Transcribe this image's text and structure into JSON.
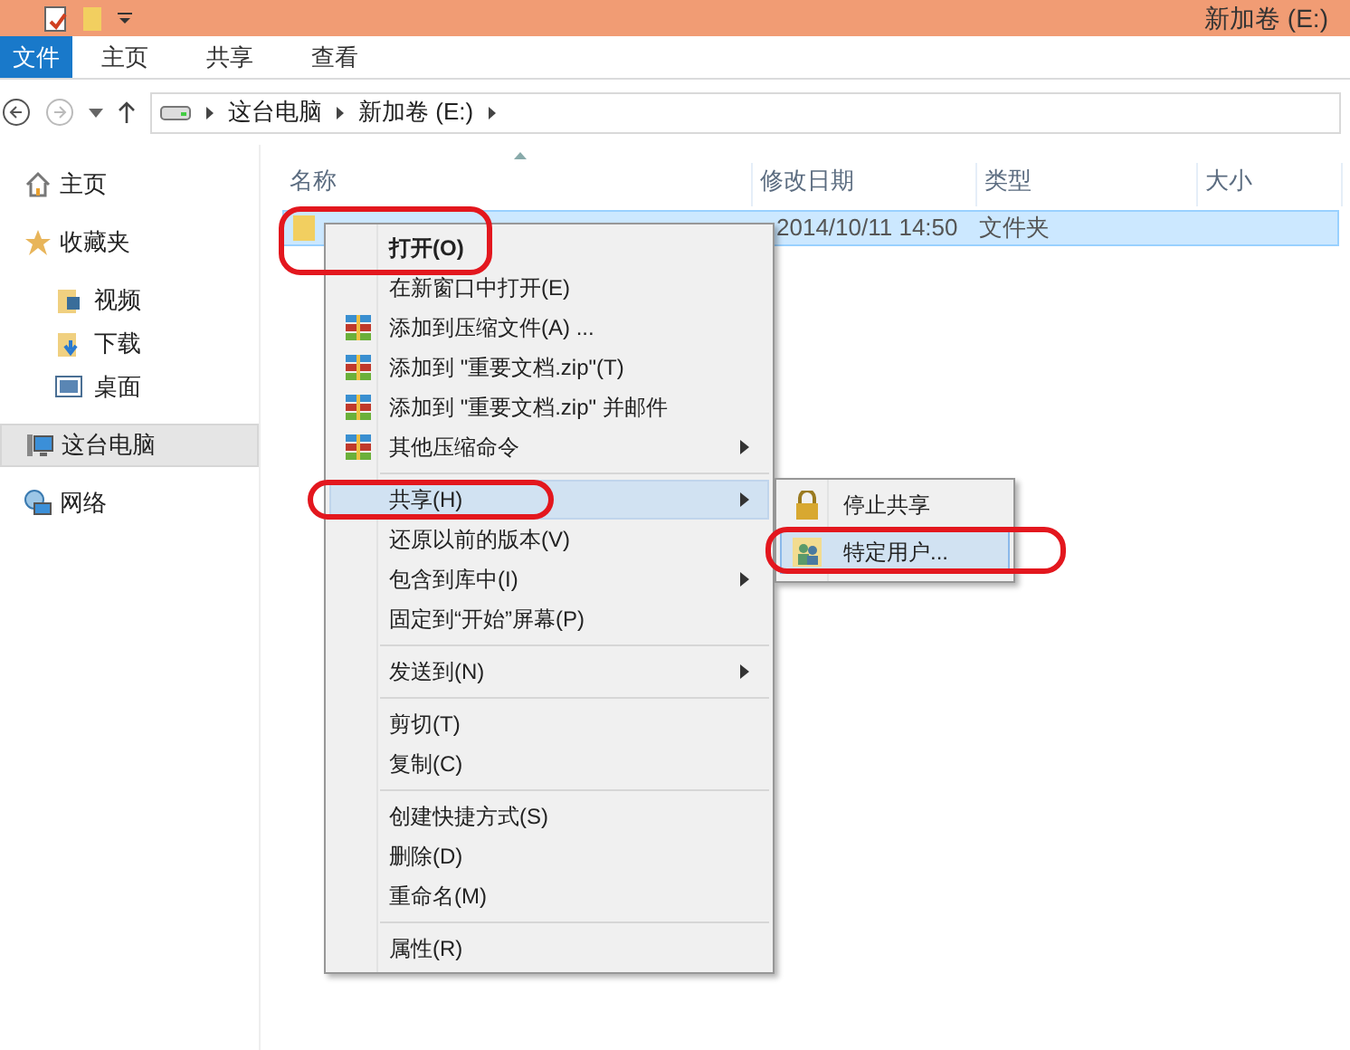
{
  "window": {
    "title": "新加卷 (E:)"
  },
  "ribbon_tabs": [
    {
      "label": "文件",
      "selected": true
    },
    {
      "label": "主页",
      "selected": false
    },
    {
      "label": "共享",
      "selected": false
    },
    {
      "label": "查看",
      "selected": false
    }
  ],
  "breadcrumb": [
    "这台电脑",
    "新加卷 (E:)"
  ],
  "sidebar": {
    "items": [
      {
        "label": "主页",
        "kind": "home",
        "selected": false
      },
      {
        "label": "收藏夹",
        "kind": "star",
        "selected": false,
        "children": [
          {
            "label": "视频",
            "kind": "video",
            "selected": false
          },
          {
            "label": "下载",
            "kind": "download",
            "selected": false
          },
          {
            "label": "桌面",
            "kind": "desktop",
            "selected": false
          }
        ]
      },
      {
        "label": "这台电脑",
        "kind": "pc",
        "selected": true
      },
      {
        "label": "网络",
        "kind": "network",
        "selected": false
      }
    ]
  },
  "table": {
    "columns": [
      "名称",
      "修改日期",
      "类型",
      "大小"
    ],
    "rows": [
      {
        "modified": "2014/10/11 14:50",
        "type": "文件夹",
        "selected": true
      }
    ]
  },
  "context_menu": [
    {
      "kind": "plain",
      "label": "打开(O)",
      "bold": true,
      "submenu": false,
      "selected": false,
      "highlighted": true
    },
    {
      "kind": "plain",
      "label": "在新窗口中打开(E)",
      "bold": false,
      "submenu": false,
      "selected": false,
      "highlighted": false
    },
    {
      "kind": "archive",
      "label": "添加到压缩文件(A) ...",
      "bold": false,
      "submenu": false,
      "selected": false,
      "highlighted": false
    },
    {
      "kind": "archive",
      "label": "添加到 \"重要文档.zip\"(T)",
      "bold": false,
      "submenu": false,
      "selected": false,
      "highlighted": false
    },
    {
      "kind": "archive",
      "label": "添加到 \"重要文档.zip\" 并邮件",
      "bold": false,
      "submenu": false,
      "selected": false,
      "highlighted": false
    },
    {
      "kind": "archive",
      "label": "其他压缩命令",
      "bold": false,
      "submenu": true,
      "selected": false,
      "highlighted": false
    },
    {
      "kind": "separator"
    },
    {
      "kind": "plain",
      "label": "共享(H)",
      "bold": false,
      "submenu": true,
      "selected": true,
      "highlighted": true
    },
    {
      "kind": "plain",
      "label": "还原以前的版本(V)",
      "bold": false,
      "submenu": false,
      "selected": false,
      "highlighted": false
    },
    {
      "kind": "plain",
      "label": "包含到库中(I)",
      "bold": false,
      "submenu": true,
      "selected": false,
      "highlighted": false
    },
    {
      "kind": "plain",
      "label": "固定到“开始”屏幕(P)",
      "bold": false,
      "submenu": false,
      "selected": false,
      "highlighted": false
    },
    {
      "kind": "separator"
    },
    {
      "kind": "plain",
      "label": "发送到(N)",
      "bold": false,
      "submenu": true,
      "selected": false,
      "highlighted": false
    },
    {
      "kind": "separator"
    },
    {
      "kind": "plain",
      "label": "剪切(T)",
      "bold": false,
      "submenu": false,
      "selected": false,
      "highlighted": false
    },
    {
      "kind": "plain",
      "label": "复制(C)",
      "bold": false,
      "submenu": false,
      "selected": false,
      "highlighted": false
    },
    {
      "kind": "separator"
    },
    {
      "kind": "plain",
      "label": "创建快捷方式(S)",
      "bold": false,
      "submenu": false,
      "selected": false,
      "highlighted": false
    },
    {
      "kind": "plain",
      "label": "删除(D)",
      "bold": false,
      "submenu": false,
      "selected": false,
      "highlighted": false
    },
    {
      "kind": "plain",
      "label": "重命名(M)",
      "bold": false,
      "submenu": false,
      "selected": false,
      "highlighted": false
    },
    {
      "kind": "separator"
    },
    {
      "kind": "plain",
      "label": "属性(R)",
      "bold": false,
      "submenu": false,
      "selected": false,
      "highlighted": false
    }
  ],
  "share_submenu": [
    {
      "label": "停止共享",
      "kind": "lock",
      "selected": false,
      "highlighted": false
    },
    {
      "label": "特定用户...",
      "kind": "users",
      "selected": true,
      "highlighted": true
    }
  ]
}
